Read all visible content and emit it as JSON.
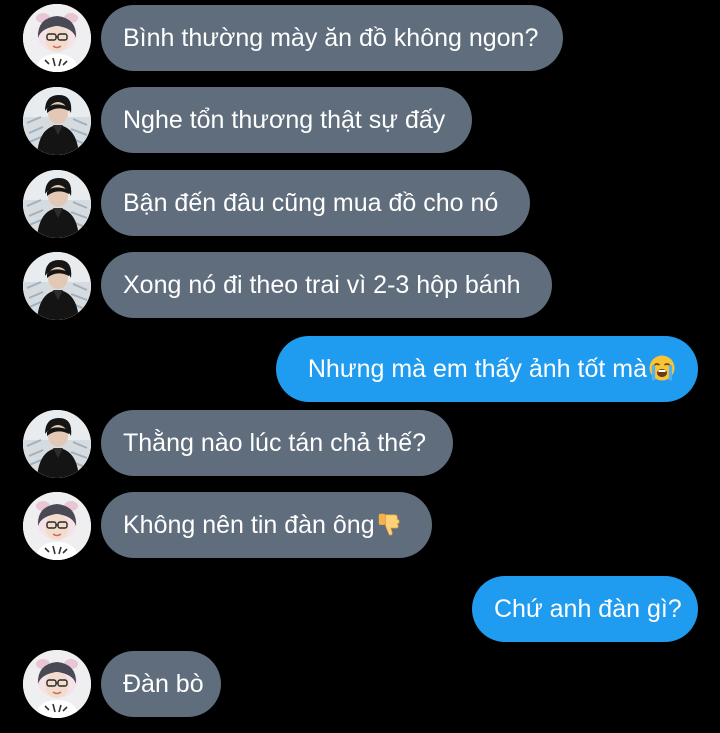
{
  "theme": {
    "background": "#000000",
    "incoming_bubble": "#5f6d7c",
    "outgoing_bubble": "#1f9cf0",
    "text_color": "#ffffff"
  },
  "messages": [
    {
      "sender": "girl",
      "direction": "incoming",
      "text": "Bình thường mày ăn đồ không ngon?"
    },
    {
      "sender": "boy",
      "direction": "incoming",
      "text": "Nghe tổn thương thật sự đấy"
    },
    {
      "sender": "boy",
      "direction": "incoming",
      "text": "Bận đến đâu cũng mua đồ cho nó"
    },
    {
      "sender": "boy",
      "direction": "incoming",
      "text": "Xong nó đi theo trai vì 2-3 hộp bánh"
    },
    {
      "sender": "me",
      "direction": "outgoing",
      "text": "Nhưng mà em thấy ảnh tốt mà",
      "emoji": "loudly-crying-face-icon"
    },
    {
      "sender": "boy",
      "direction": "incoming",
      "text": "Thằng nào lúc tán chả thế?"
    },
    {
      "sender": "girl",
      "direction": "incoming",
      "text": "Không nên tin đàn ông",
      "emoji": "thumbs-down-icon"
    },
    {
      "sender": "me",
      "direction": "outgoing",
      "text": "Chứ anh đàn gì?"
    },
    {
      "sender": "girl",
      "direction": "incoming",
      "text": "Đàn bò"
    }
  ]
}
